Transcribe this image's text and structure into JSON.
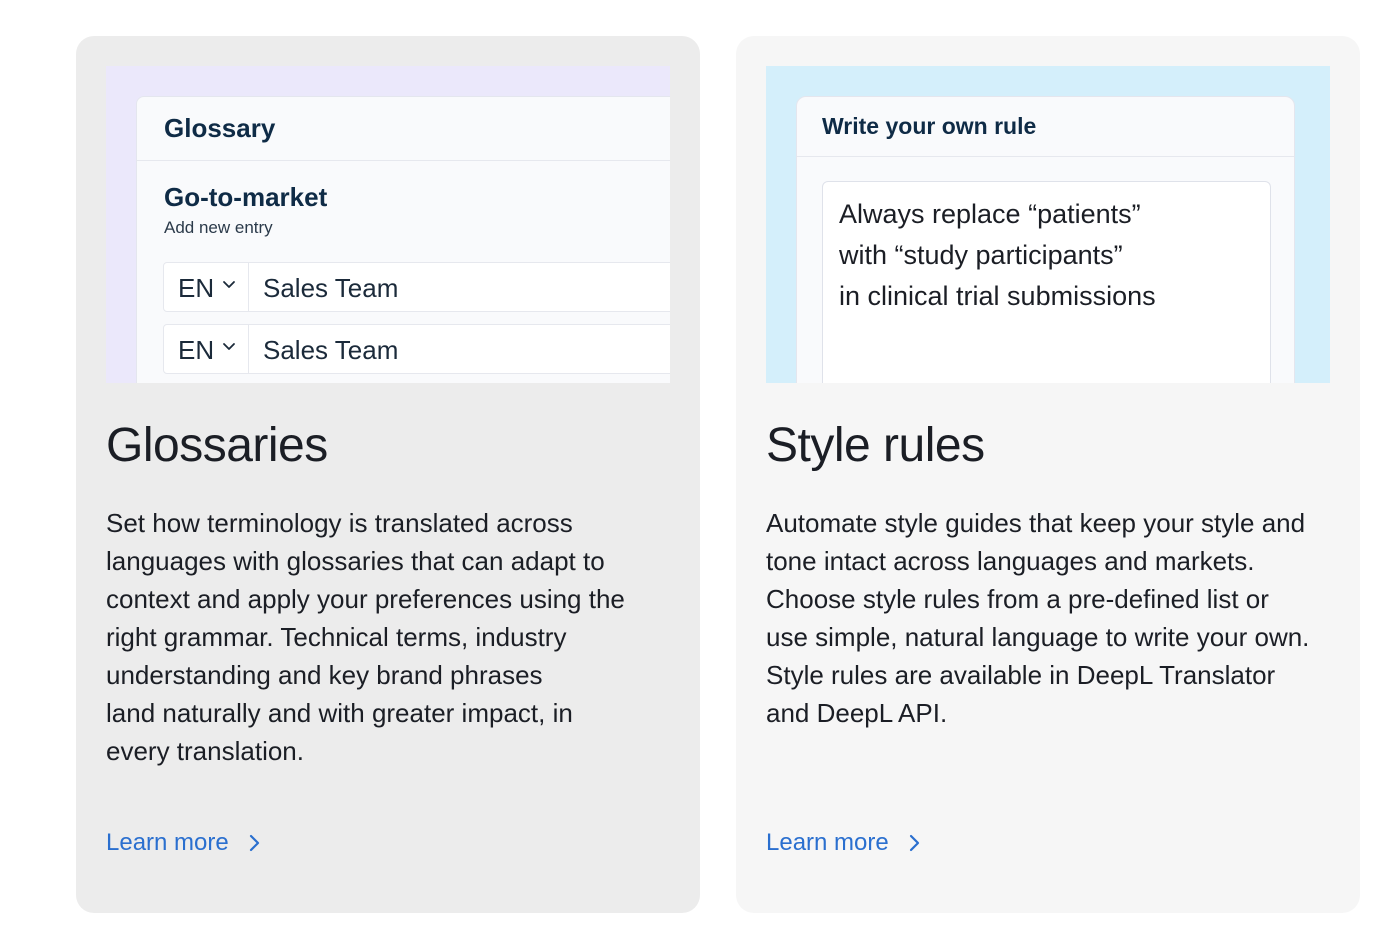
{
  "cards": [
    {
      "illustration": {
        "panel_title": "Glossary",
        "list_title": "Go-to-market",
        "add_entry": "Add new entry",
        "rows": [
          {
            "lang": "EN",
            "term": "Sales Team"
          },
          {
            "lang": "EN",
            "term": "Sales Team"
          }
        ]
      },
      "title": "Glossaries",
      "body_lines": [
        "Set how terminology is translated across",
        "languages with glossaries that can adapt to",
        "context and apply your preferences using the",
        "right grammar. Technical terms, industry",
        "understanding and key brand phrases",
        "land naturally and with greater impact, in",
        "every translation."
      ],
      "link": "Learn more"
    },
    {
      "illustration": {
        "panel_title": "Write your own rule",
        "rule_lines": [
          "Always replace “patients”",
          "with “study participants”",
          "in clinical trial submissions"
        ]
      },
      "title": "Style rules",
      "body_lines": [
        "Automate style guides that keep your style and",
        "tone intact across languages and markets.",
        "Choose style rules from a pre-defined list or",
        "use simple, natural language to write your own.",
        "Style rules are available in DeepL Translator",
        "and DeepL API."
      ],
      "link": "Learn more"
    }
  ],
  "colors": {
    "link": "#2a6fcf",
    "glossary_illustration_bg": "#ebe8fb",
    "style_illustration_bg": "#d4effb",
    "card_1_bg": "#ececec",
    "card_2_bg": "#f6f6f6",
    "panel_heading": "#0f2b46"
  },
  "icons": {
    "lang_dropdown": "chevron-down-icon",
    "link_arrow": "chevron-right-icon"
  }
}
